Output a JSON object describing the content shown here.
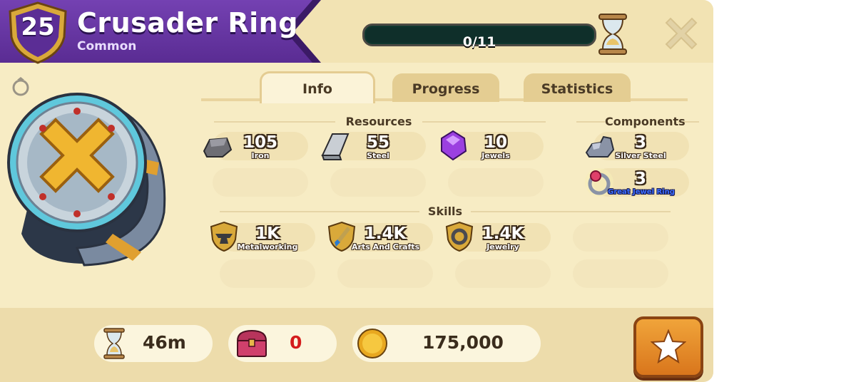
{
  "header": {
    "level": "25",
    "title": "Crusader Ring",
    "rarity": "Common",
    "progress_text": "0/11",
    "progress_fraction": 0
  },
  "tabs": [
    {
      "label": "Info",
      "active": true
    },
    {
      "label": "Progress",
      "active": false
    },
    {
      "label": "Statistics",
      "active": false
    }
  ],
  "resources": {
    "heading": "Resources",
    "items": [
      {
        "count": "105",
        "label": "Iron",
        "icon": "iron-ingot-icon"
      },
      {
        "count": "55",
        "label": "Steel",
        "icon": "steel-bar-icon"
      },
      {
        "count": "10",
        "label": "Jewels",
        "icon": "purple-jewel-icon"
      }
    ]
  },
  "components": {
    "heading": "Components",
    "items": [
      {
        "count": "3",
        "label": "Silver Steel",
        "icon": "silver-steel-icon"
      },
      {
        "count": "3",
        "label": "Great Jewel Ring",
        "icon": "jewel-ring-icon"
      }
    ]
  },
  "skills": {
    "heading": "Skills",
    "items": [
      {
        "count": "1K",
        "label": "Metalworking",
        "icon": "anvil-shield-icon"
      },
      {
        "count": "1.4K",
        "label": "Arts And Crafts",
        "icon": "brush-shield-icon"
      },
      {
        "count": "1.4K",
        "label": "Jewelry",
        "icon": "ring-shield-icon"
      }
    ]
  },
  "footer": {
    "time": "46m",
    "chest_count": "0",
    "price": "175,000"
  },
  "colors": {
    "banner": "#5a2c93",
    "panel": "#f7ecc4",
    "accent_orange": "#e58a2a",
    "progress_track": "#0f2f2a"
  }
}
